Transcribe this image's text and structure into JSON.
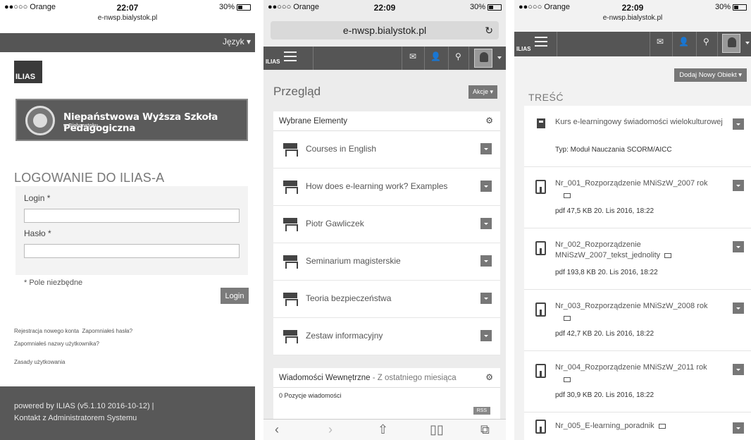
{
  "phone1": {
    "status": {
      "carrier": "●●○○○ Orange",
      "time": "22:07",
      "battery": "30%"
    },
    "url": "e-nwsp.bialystok.pl",
    "lang_button": "Język ▾",
    "logo_text": "ILIAS",
    "banner_title": "Niepaństwowa Wyższa Szkoła Pedagogiczna",
    "banner_sub": "w Białymstoku",
    "login_title": "LOGOWANIE DO ILIAS-A",
    "login_label": "Login *",
    "password_label": "Hasło *",
    "login_value": "",
    "password_value": "",
    "required_note": "* Pole niezbędne",
    "login_button": "Login",
    "link_register": "Rejestracja nowego konta",
    "link_forgot_password": "Zapomniałeś hasła?",
    "link_forgot_username": "Zapomniałeś nazwy użytkownika?",
    "link_terms": "Zasady użytkowania",
    "footer_powered": "powered by ILIAS (v5.1.10 2016-10-12) |",
    "footer_contact": "Kontakt z Administratorem Systemu"
  },
  "phone2": {
    "status": {
      "carrier": "●●○○○ Orange",
      "time": "22:09",
      "battery": "30%"
    },
    "url": "e-nwsp.bialystok.pl",
    "logo_text": "ILIAS",
    "page_title": "Przegląd",
    "actions_button": "Akcje ▾",
    "selected_panel_title": "Wybrane Elementy",
    "selected_items": [
      {
        "label": "Courses in English"
      },
      {
        "label": "How does e-learning work? Examples"
      },
      {
        "label": "Piotr Gawliczek"
      },
      {
        "label": "Seminarium magisterskie"
      },
      {
        "label": "Teoria bezpieczeństwa"
      },
      {
        "label": "Zestaw informacyjny"
      }
    ],
    "messages_panel_title": "Wiadomości Wewnętrzne",
    "messages_panel_subtitle": " - Z ostatniego miesiąca",
    "messages_count": "0 Pozycje wiadomości",
    "rss_label": "RSS"
  },
  "phone3": {
    "status": {
      "carrier": "●●○○○ Orange",
      "time": "22:09",
      "battery": "30%"
    },
    "url": "e-nwsp.bialystok.pl",
    "logo_text": "ILIAS",
    "add_button": "Dodaj Nowy Obiekt ▾",
    "section_title": "TREŚĆ",
    "items": [
      {
        "title": "Kurs e-learningowy świadomości wielokulturowej",
        "meta": "Typ: Moduł Nauczania SCORM/AICC"
      },
      {
        "title": "Nr_001_Rozporządzenie MNiSzW_2007 rok",
        "meta": "pdf   47,5 KB   20. Lis 2016, 18:22"
      },
      {
        "title": "Nr_002_Rozporządzenie MNiSzW_2007_tekst_jednolity",
        "meta": "pdf   193,8 KB   20. Lis 2016, 18:22"
      },
      {
        "title": "Nr_003_Rozporządzenie MNiSzW_2008 rok",
        "meta": "pdf   42,7 KB   20. Lis 2016, 18:22"
      },
      {
        "title": "Nr_004_Rozporządzenie MNiSzW_2011 rok",
        "meta": "pdf   30,9 KB   20. Lis 2016, 18:22"
      },
      {
        "title": "Nr_005_E-learning_poradnik",
        "meta": ""
      }
    ]
  }
}
